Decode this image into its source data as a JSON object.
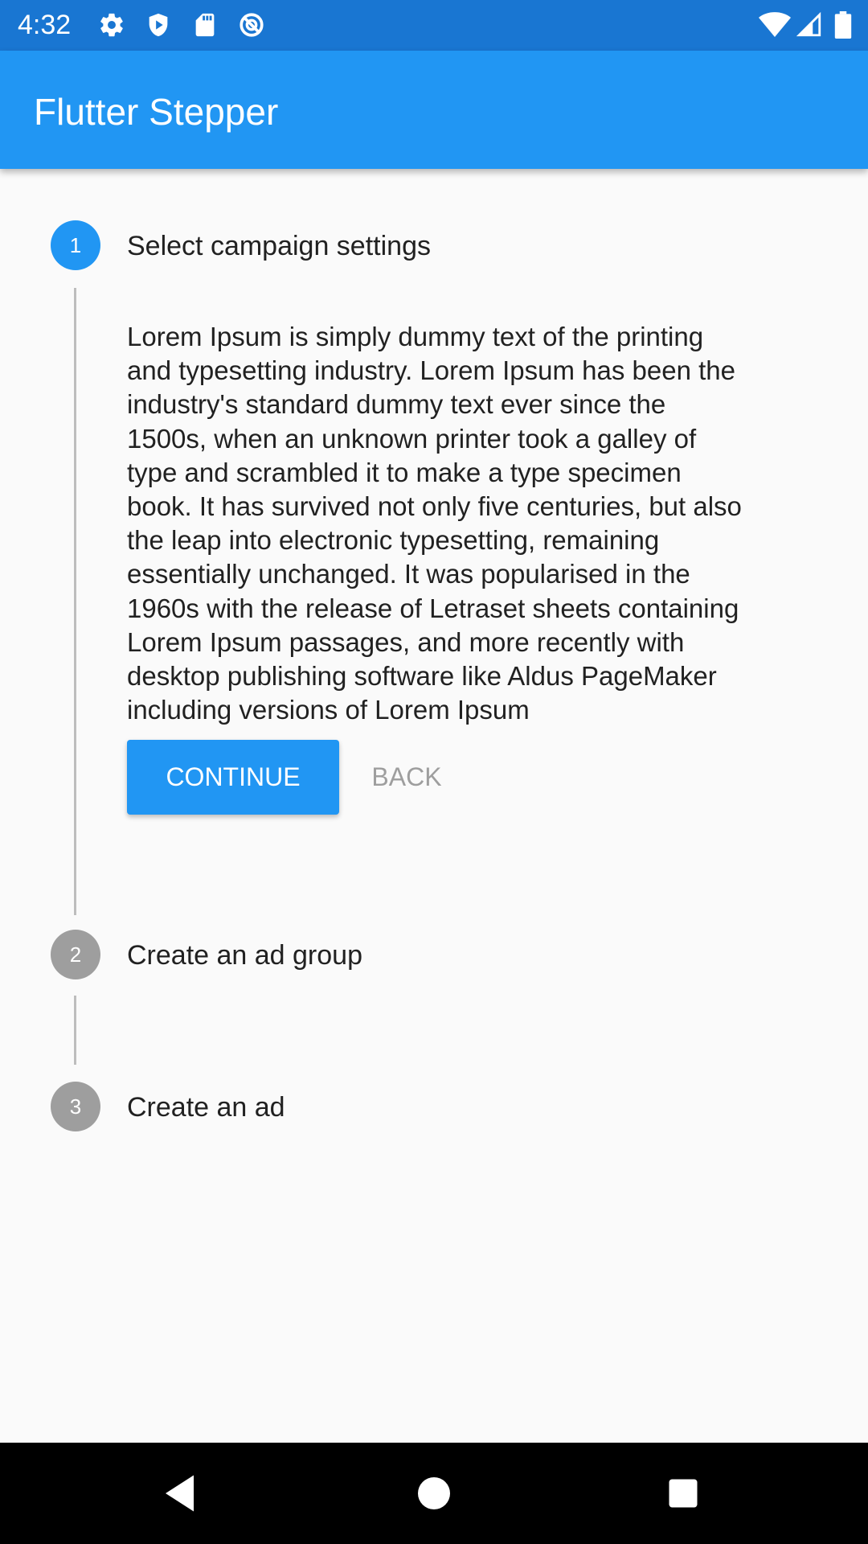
{
  "status_bar": {
    "time": "4:32",
    "left_icons": [
      "gear-icon",
      "shield-play-icon",
      "sd-card-icon",
      "no-sync-icon"
    ],
    "right_icons": [
      "wifi-icon",
      "cell-signal-icon",
      "battery-icon"
    ],
    "color": "#1976d2"
  },
  "app_bar": {
    "title": "Flutter Stepper",
    "color": "#2196f3"
  },
  "stepper": {
    "steps": [
      {
        "number": "1",
        "title": "Select campaign settings",
        "state": "active"
      },
      {
        "number": "2",
        "title": "Create an ad group",
        "state": "inactive"
      },
      {
        "number": "3",
        "title": "Create an ad",
        "state": "inactive"
      }
    ],
    "content_lines": [
      "Lorem Ipsum is simply dummy text of the printing",
      "and typesetting industry. Lorem Ipsum has been the",
      "industry's standard dummy text ever since the",
      "1500s, when an unknown printer took a galley of",
      "type and scrambled it to make a type specimen",
      "book. It has survived not only five centuries, but also",
      "the leap into electronic typesetting, remaining",
      "essentially unchanged. It was popularised in the",
      "1960s with the release of Letraset sheets containing",
      "Lorem Ipsum passages, and more recently with",
      "desktop publishing software like Aldus PageMaker",
      "including versions of Lorem Ipsum"
    ],
    "continue_label": "CONTINUE",
    "back_label": "BACK",
    "active_color": "#2196f3",
    "inactive_color": "#9e9e9e"
  },
  "nav_bar": {
    "buttons": [
      "back-triangle-icon",
      "home-circle-icon",
      "recents-square-icon"
    ]
  }
}
